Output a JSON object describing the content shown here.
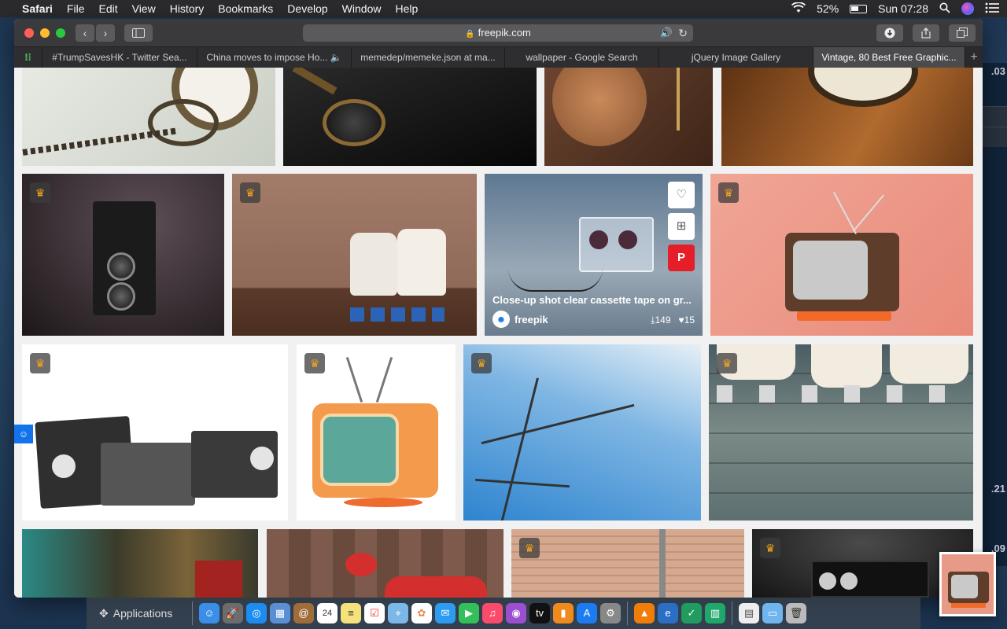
{
  "menubar": {
    "app": "Safari",
    "items": [
      "File",
      "Edit",
      "View",
      "History",
      "Bookmarks",
      "Develop",
      "Window",
      "Help"
    ],
    "battery": "52%",
    "clock": "Sun 07:28"
  },
  "desktop": {
    "right_labels": [
      ".03",
      ".21",
      ".09"
    ]
  },
  "toolbar": {
    "url": "freepik.com"
  },
  "tabs": [
    {
      "label": "#TrumpSavesHK - Twitter Sea..."
    },
    {
      "label": "China moves to impose Ho..."
    },
    {
      "label": "memedep/memeke.json at ma..."
    },
    {
      "label": "wallpaper - Google Search"
    },
    {
      "label": "jQuery Image Gallery"
    },
    {
      "label": "Vintage, 80 Best Free Graphic..."
    }
  ],
  "hover_card": {
    "title": "Close-up shot clear cassette tape on gr...",
    "author": "freepik",
    "downloads": "149",
    "likes": "15"
  },
  "dock": {
    "applications_label": "Applications",
    "calendar_day": "24"
  },
  "colors": {
    "accent_blue": "#1273eb",
    "premium_crown": "#f3a51c",
    "pinterest": "#e51e2a"
  }
}
